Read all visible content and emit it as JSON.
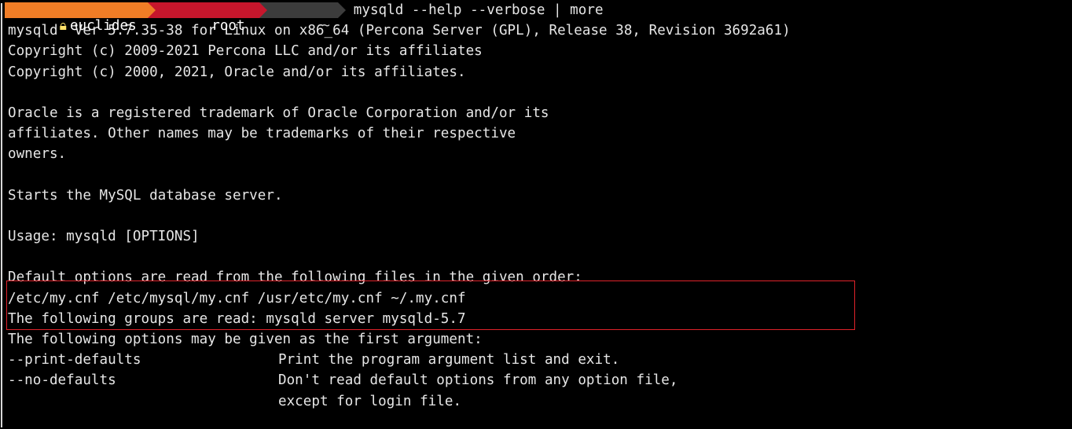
{
  "prompt": {
    "host": "euclides",
    "user": "root",
    "dir": "~",
    "command": "mysqld --help --verbose | more",
    "colors": {
      "host_bg": "#f07d26",
      "user_bg": "#c6162c",
      "dir_bg": "#3c3c3c"
    }
  },
  "output": {
    "version": "mysqld  Ver 5.7.35-38 for Linux on x86_64 (Percona Server (GPL), Release 38, Revision 3692a61)",
    "copyright1": "Copyright (c) 2009-2021 Percona LLC and/or its affiliates",
    "copyright2": "Copyright (c) 2000, 2021, Oracle and/or its affiliates.",
    "trademark1": "Oracle is a registered trademark of Oracle Corporation and/or its",
    "trademark2": "affiliates. Other names may be trademarks of their respective",
    "trademark3": "owners.",
    "starts": "Starts the MySQL database server.",
    "usage": "Usage: mysqld [OPTIONS]",
    "defaults1": "Default options are read from the following files in the given order:",
    "defaults2": "/etc/my.cnf /etc/mysql/my.cnf /usr/etc/my.cnf ~/.my.cnf",
    "groups": "The following groups are read: mysqld server mysqld-5.7",
    "options_intro": "The following options may be given as the first argument:",
    "options": [
      {
        "name": "--print-defaults",
        "desc": "Print the program argument list and exit."
      },
      {
        "name": "--no-defaults",
        "desc": "Don't read default options from any option file,"
      },
      {
        "name": "",
        "desc": "except for login file."
      }
    ]
  },
  "annotation": {
    "highlight_color": "#e0222a"
  }
}
